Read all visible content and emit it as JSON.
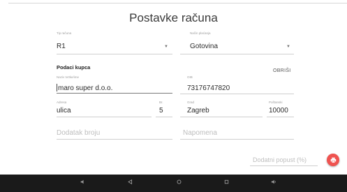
{
  "title": "Postavke računa",
  "tip_racuna": {
    "label": "Tip računa",
    "value": "R1"
  },
  "nacin_placanja": {
    "label": "Način plaćanja",
    "value": "Gotovina"
  },
  "podaci_kupca": {
    "heading": "Podaci kupca",
    "clear_label": "OBRIŠI",
    "naziv": {
      "label": "Naziv tvrtke/ime",
      "value": "maro super d.o.o."
    },
    "oib": {
      "label": "OIB",
      "value": "73176747820"
    },
    "adresa": {
      "label": "Adresa",
      "value": "ulica"
    },
    "broj": {
      "label": "Br.",
      "value": "5"
    },
    "grad": {
      "label": "Grad",
      "value": "Zagreb"
    },
    "postanski": {
      "label": "Poštanski",
      "value": "10000"
    }
  },
  "dodatak_broju": {
    "placeholder": "Dodatak broju"
  },
  "napomena": {
    "placeholder": "Napomena"
  },
  "popust": {
    "placeholder": "Dodatni popust (%)"
  },
  "icons": {
    "dropdown": "caret-down-icon",
    "fab": "printer-icon",
    "nav": [
      "volume-down-icon",
      "back-icon",
      "home-icon",
      "recents-icon",
      "volume-up-icon"
    ]
  },
  "colors": {
    "accent": "#ef5350",
    "navbar": "#1a1a1a"
  }
}
